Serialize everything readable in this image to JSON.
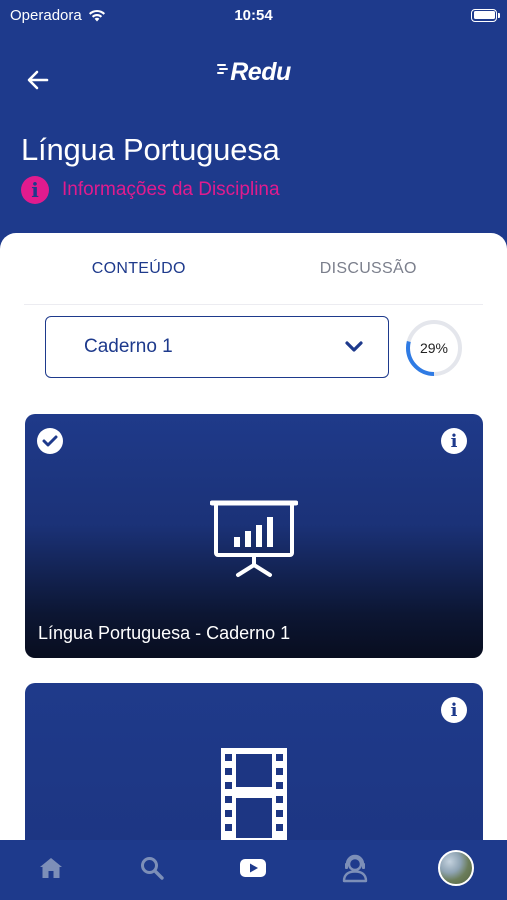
{
  "status_bar": {
    "carrier": "Operadora",
    "time": "10:54"
  },
  "header": {
    "brand": "Redu"
  },
  "page": {
    "title": "Língua Portuguesa",
    "info_link": "Informações da Disciplina"
  },
  "tabs": [
    {
      "label": "CONTEÚDO",
      "active": true
    },
    {
      "label": "DISCUSSÃO",
      "active": false
    }
  ],
  "notebook_select": {
    "value": "Caderno 1"
  },
  "progress": {
    "percent": 29,
    "label": "29%"
  },
  "cards": [
    {
      "title": "Língua Portuguesa - Caderno 1",
      "completed": true,
      "icon": "presentation-icon"
    },
    {
      "title": "",
      "completed": false,
      "icon": "film-icon"
    }
  ],
  "tabbar": {
    "items": [
      "home-icon",
      "search-icon",
      "video-icon",
      "support-icon",
      "avatar"
    ],
    "selected": "video-icon"
  },
  "colors": {
    "primary": "#1e3a8c",
    "accent": "#e11b8e",
    "progress": "#2f7be4"
  }
}
